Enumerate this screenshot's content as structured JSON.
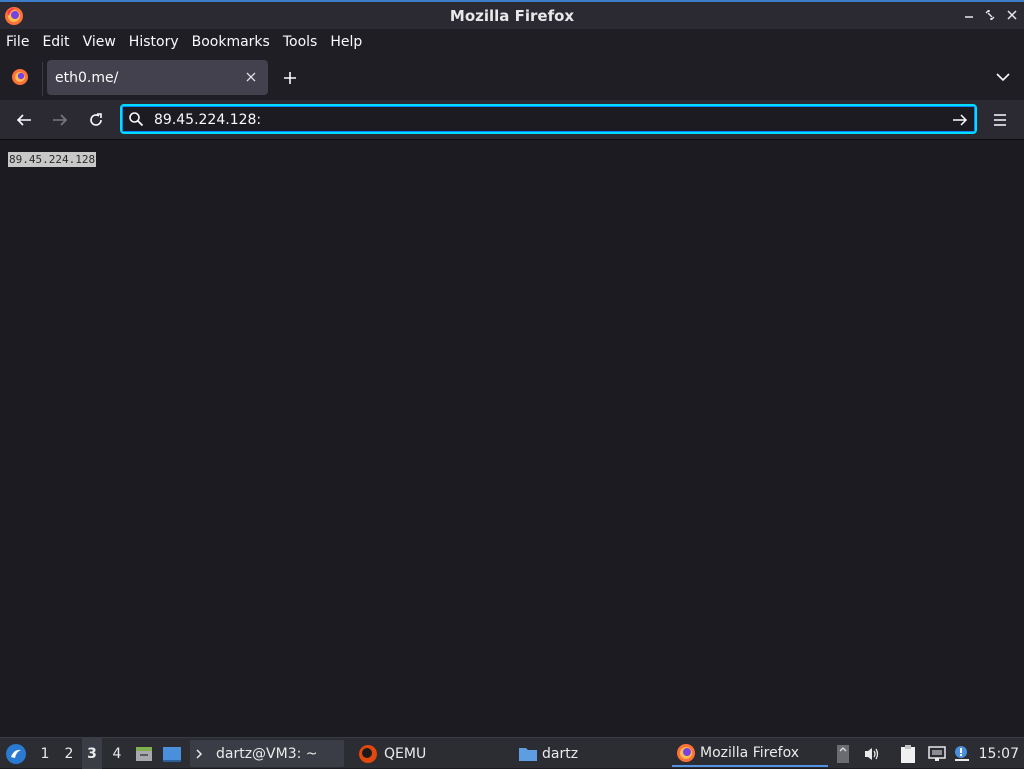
{
  "window": {
    "title": "Mozilla Firefox",
    "controls": [
      "minimize",
      "restore",
      "close"
    ]
  },
  "menubar": {
    "items": [
      {
        "label": "File"
      },
      {
        "label": "Edit"
      },
      {
        "label": "View"
      },
      {
        "label": "History"
      },
      {
        "label": "Bookmarks"
      },
      {
        "label": "Tools"
      },
      {
        "label": "Help"
      }
    ]
  },
  "tabs": [
    {
      "label": "eth0.me/",
      "active": true
    }
  ],
  "navbar": {
    "url_value": "89.45.224.128:",
    "back_enabled": true,
    "forward_enabled": false
  },
  "content": {
    "text": "89.45.224.128",
    "selected": true
  },
  "taskbar": {
    "workspaces": [
      "1",
      "2",
      "3",
      "4"
    ],
    "active_workspace": "3",
    "tasks": [
      {
        "label": "dartz@VM3: ~",
        "icon": "terminal-icon"
      },
      {
        "label": "QEMU",
        "icon": "qemu-icon"
      },
      {
        "label": "dartz",
        "icon": "folder-icon"
      },
      {
        "label": "Mozilla Firefox",
        "icon": "firefox-icon",
        "active": true
      }
    ],
    "clock": "15:07"
  },
  "colors": {
    "accent": "#00ddff",
    "content_bg": "#1c1b22",
    "toolbar_bg": "#2b2a33"
  }
}
